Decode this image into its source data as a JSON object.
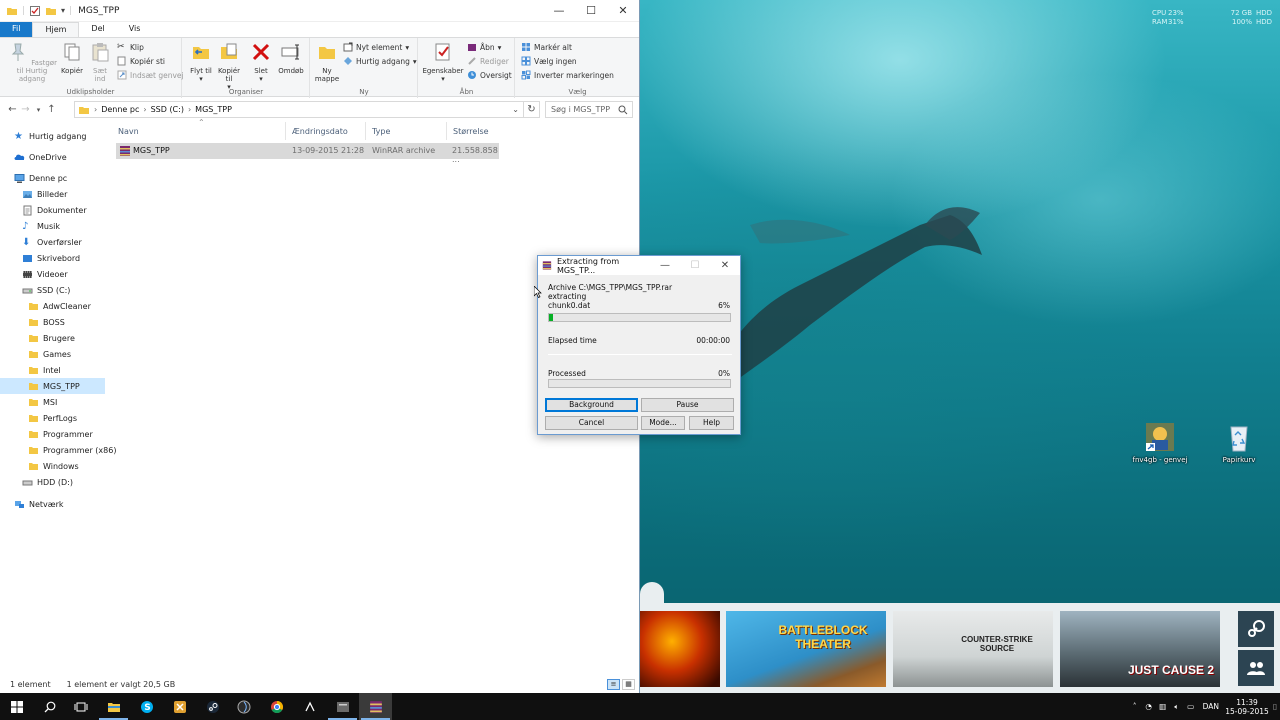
{
  "sysmon": {
    "cpu_label": "CPU",
    "cpu_val": "23%",
    "ram_label": "RAM",
    "ram_val": "31%",
    "disk_val": "72 GB",
    "disk_label": "HDD",
    "disk_pct": "100%",
    "disk_pct_label": "HDD"
  },
  "desktop_icons": [
    {
      "label": "fnv4gb - genvej"
    },
    {
      "label": "Papirkurv"
    }
  ],
  "gamebar": {
    "tiles": [
      {
        "label": ""
      },
      {
        "label": "BATTLEBLOCK THEATER"
      },
      {
        "label": "COUNTER-STRIKE SOURCE"
      },
      {
        "label": "JUST CAUSE 2"
      }
    ]
  },
  "explorer": {
    "title": "MGS_TPP",
    "tabs": {
      "file": "Fil",
      "home": "Hjem",
      "share": "Del",
      "view": "Vis"
    },
    "ribbon": {
      "pin": "Fastgør til Hurtig adgang",
      "copy": "Kopiér",
      "paste": "Sæt ind",
      "cut": "Klip",
      "copy_path": "Kopiér sti",
      "paste_shortcut": "Indsæt genvej",
      "group_clipboard": "Udklipsholder",
      "move_to": "Flyt til",
      "copy_to": "Kopiér til",
      "delete": "Slet",
      "rename": "Omdøb",
      "group_organize": "Organiser",
      "new_folder": "Ny mappe",
      "new_item": "Nyt element",
      "easy_access": "Hurtig adgang",
      "group_new": "Ny",
      "properties": "Egenskaber",
      "open": "Åbn",
      "edit": "Rediger",
      "history": "Oversigt",
      "group_open": "Åbn",
      "select_all": "Markér alt",
      "select_none": "Vælg ingen",
      "invert_selection": "Inverter markeringen",
      "group_select": "Vælg"
    },
    "address": {
      "crumbs": [
        "Denne pc",
        "SSD (C:)",
        "MGS_TPP"
      ]
    },
    "search_placeholder": "Søg i MGS_TPP",
    "nav": {
      "quick_access": "Hurtig adgang",
      "onedrive": "OneDrive",
      "this_pc": "Denne pc",
      "libraries": [
        "Billeder",
        "Dokumenter",
        "Musik",
        "Overførsler",
        "Skrivebord",
        "Videoer"
      ],
      "ssd": "SSD (C:)",
      "folders": [
        "AdwCleaner",
        "BOSS",
        "Brugere",
        "Games",
        "Intel",
        "MGS_TPP",
        "MSI",
        "PerfLogs",
        "Programmer",
        "Programmer (x86)",
        "Windows"
      ],
      "hdd": "HDD (D:)",
      "network": "Netværk"
    },
    "columns": {
      "name": "Navn",
      "date": "Ændringsdato",
      "type": "Type",
      "size": "Størrelse"
    },
    "files": [
      {
        "name": "MGS_TPP",
        "date": "13-09-2015 21:28",
        "type": "WinRAR archive",
        "size": "21.558.858 ..."
      }
    ],
    "status": {
      "count": "1 element",
      "selected": "1 element er valgt  20,5 GB"
    }
  },
  "winrar": {
    "title": "Extracting from MGS_TP...",
    "archive": "Archive C:\\MGS_TPP\\MGS_TPP.rar",
    "action": "extracting",
    "file": "chunk0.dat",
    "file_pct": "6%",
    "file_progress": 0.02,
    "elapsed_label": "Elapsed time",
    "elapsed_val": "00:00:00",
    "processed_label": "Processed",
    "processed_pct": "0%",
    "buttons": {
      "background": "Background",
      "pause": "Pause",
      "cancel": "Cancel",
      "mode": "Mode...",
      "help": "Help"
    }
  },
  "taskbar": {
    "lang": "DAN",
    "time": "11:39",
    "date": "15-09-2015"
  }
}
